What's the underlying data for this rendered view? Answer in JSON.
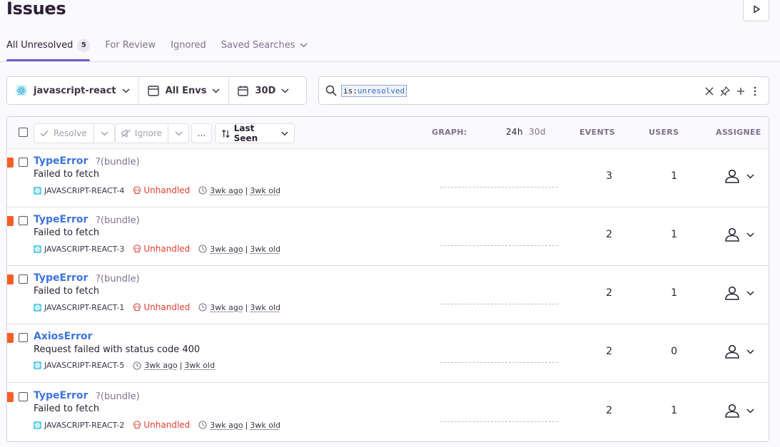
{
  "header": {
    "title": "Issues"
  },
  "tabs": [
    {
      "label": "All Unresolved",
      "count": "5",
      "active": true
    },
    {
      "label": "For Review"
    },
    {
      "label": "Ignored"
    },
    {
      "label": "Saved Searches"
    }
  ],
  "filters": {
    "project": "javascript-react",
    "environment": "All Envs",
    "period": "30D"
  },
  "search": {
    "key": "is:",
    "value": "unresolved"
  },
  "toolbar": {
    "resolve_label": "Resolve",
    "ignore_label": "Ignore",
    "more_label": "…",
    "sort_label": "Last Seen"
  },
  "columns": {
    "graph": "GRAPH:",
    "graph_24h": "24h",
    "graph_30d": "30d",
    "events": "EVENTS",
    "users": "USERS",
    "assignee": "ASSIGNEE"
  },
  "issues": [
    {
      "title": "TypeError",
      "culprit": "?(bundle)",
      "message": "Failed to fetch",
      "short_id": "JAVASCRIPT-REACT-4",
      "unhandled": "Unhandled",
      "last_seen": "3wk ago",
      "first_seen": "3wk old",
      "events": "3",
      "users": "1"
    },
    {
      "title": "TypeError",
      "culprit": "?(bundle)",
      "message": "Failed to fetch",
      "short_id": "JAVASCRIPT-REACT-3",
      "unhandled": "Unhandled",
      "last_seen": "3wk ago",
      "first_seen": "3wk old",
      "events": "2",
      "users": "1"
    },
    {
      "title": "TypeError",
      "culprit": "?(bundle)",
      "message": "Failed to fetch",
      "short_id": "JAVASCRIPT-REACT-1",
      "unhandled": "Unhandled",
      "last_seen": "3wk ago",
      "first_seen": "3wk old",
      "events": "2",
      "users": "1"
    },
    {
      "title": "AxiosError",
      "culprit": "",
      "message": "Request failed with status code 400",
      "short_id": "JAVASCRIPT-REACT-5",
      "unhandled": "",
      "last_seen": "3wk ago",
      "first_seen": "3wk old",
      "events": "2",
      "users": "0"
    },
    {
      "title": "TypeError",
      "culprit": "?(bundle)",
      "message": "Failed to fetch",
      "short_id": "JAVASCRIPT-REACT-2",
      "unhandled": "Unhandled",
      "last_seen": "3wk ago",
      "first_seen": "3wk old",
      "events": "2",
      "users": "1"
    }
  ],
  "colors": {
    "accent": "#6c5fc7",
    "link": "#3d74db",
    "error_level": "#f55f25",
    "unhandled": "#e03e2f"
  }
}
